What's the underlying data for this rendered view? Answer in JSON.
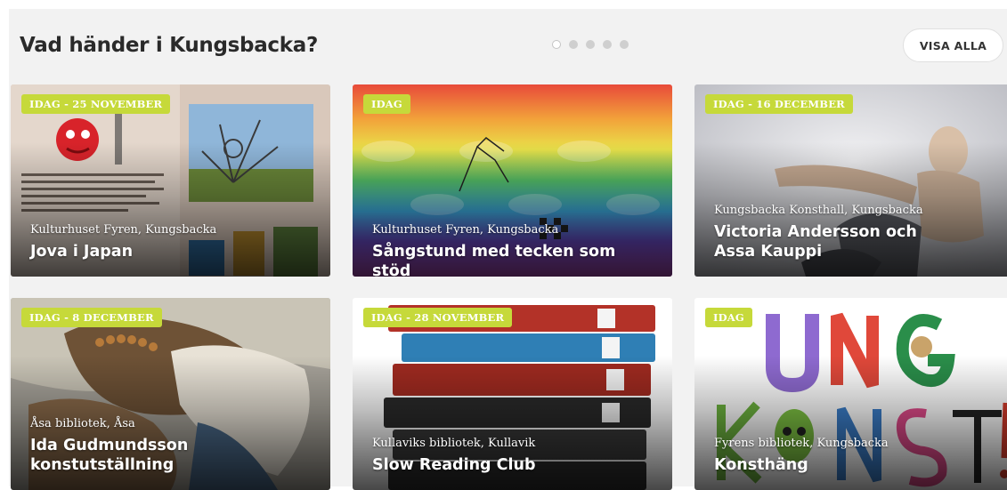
{
  "section": {
    "heading": "Vad händer i Kungsbacka?",
    "view_all_label": "VISA ALLA",
    "pagination": {
      "total": 5,
      "active": 1
    }
  },
  "colors": {
    "badge": "#c6d93a",
    "panel_bg": "#f2f2f2"
  },
  "cards": [
    {
      "badge": "IDAG - 25 NOVEMBER",
      "place": "Kulturhuset Fyren, Kungsbacka",
      "title": "Jova i Japan"
    },
    {
      "badge": "IDAG",
      "place": "Kulturhuset Fyren, Kungsbacka",
      "title": "Sångstund med tecken som stöd"
    },
    {
      "badge": "IDAG - 16 DECEMBER",
      "place": "Kungsbacka Konsthall, Kungsbacka",
      "title": "Victoria Andersson och Assa Kauppi"
    },
    {
      "badge": "IDAG - 8 DECEMBER",
      "place": "Åsa bibliotek, Åsa",
      "title": "Ida Gudmundsson konstutställning"
    },
    {
      "badge": "IDAG - 28 NOVEMBER",
      "place": "Kullaviks bibliotek, Kullavik",
      "title": "Slow Reading Club"
    },
    {
      "badge": "IDAG",
      "place": "Fyrens bibliotek, Kungsbacka",
      "title": "Konsthäng"
    }
  ]
}
